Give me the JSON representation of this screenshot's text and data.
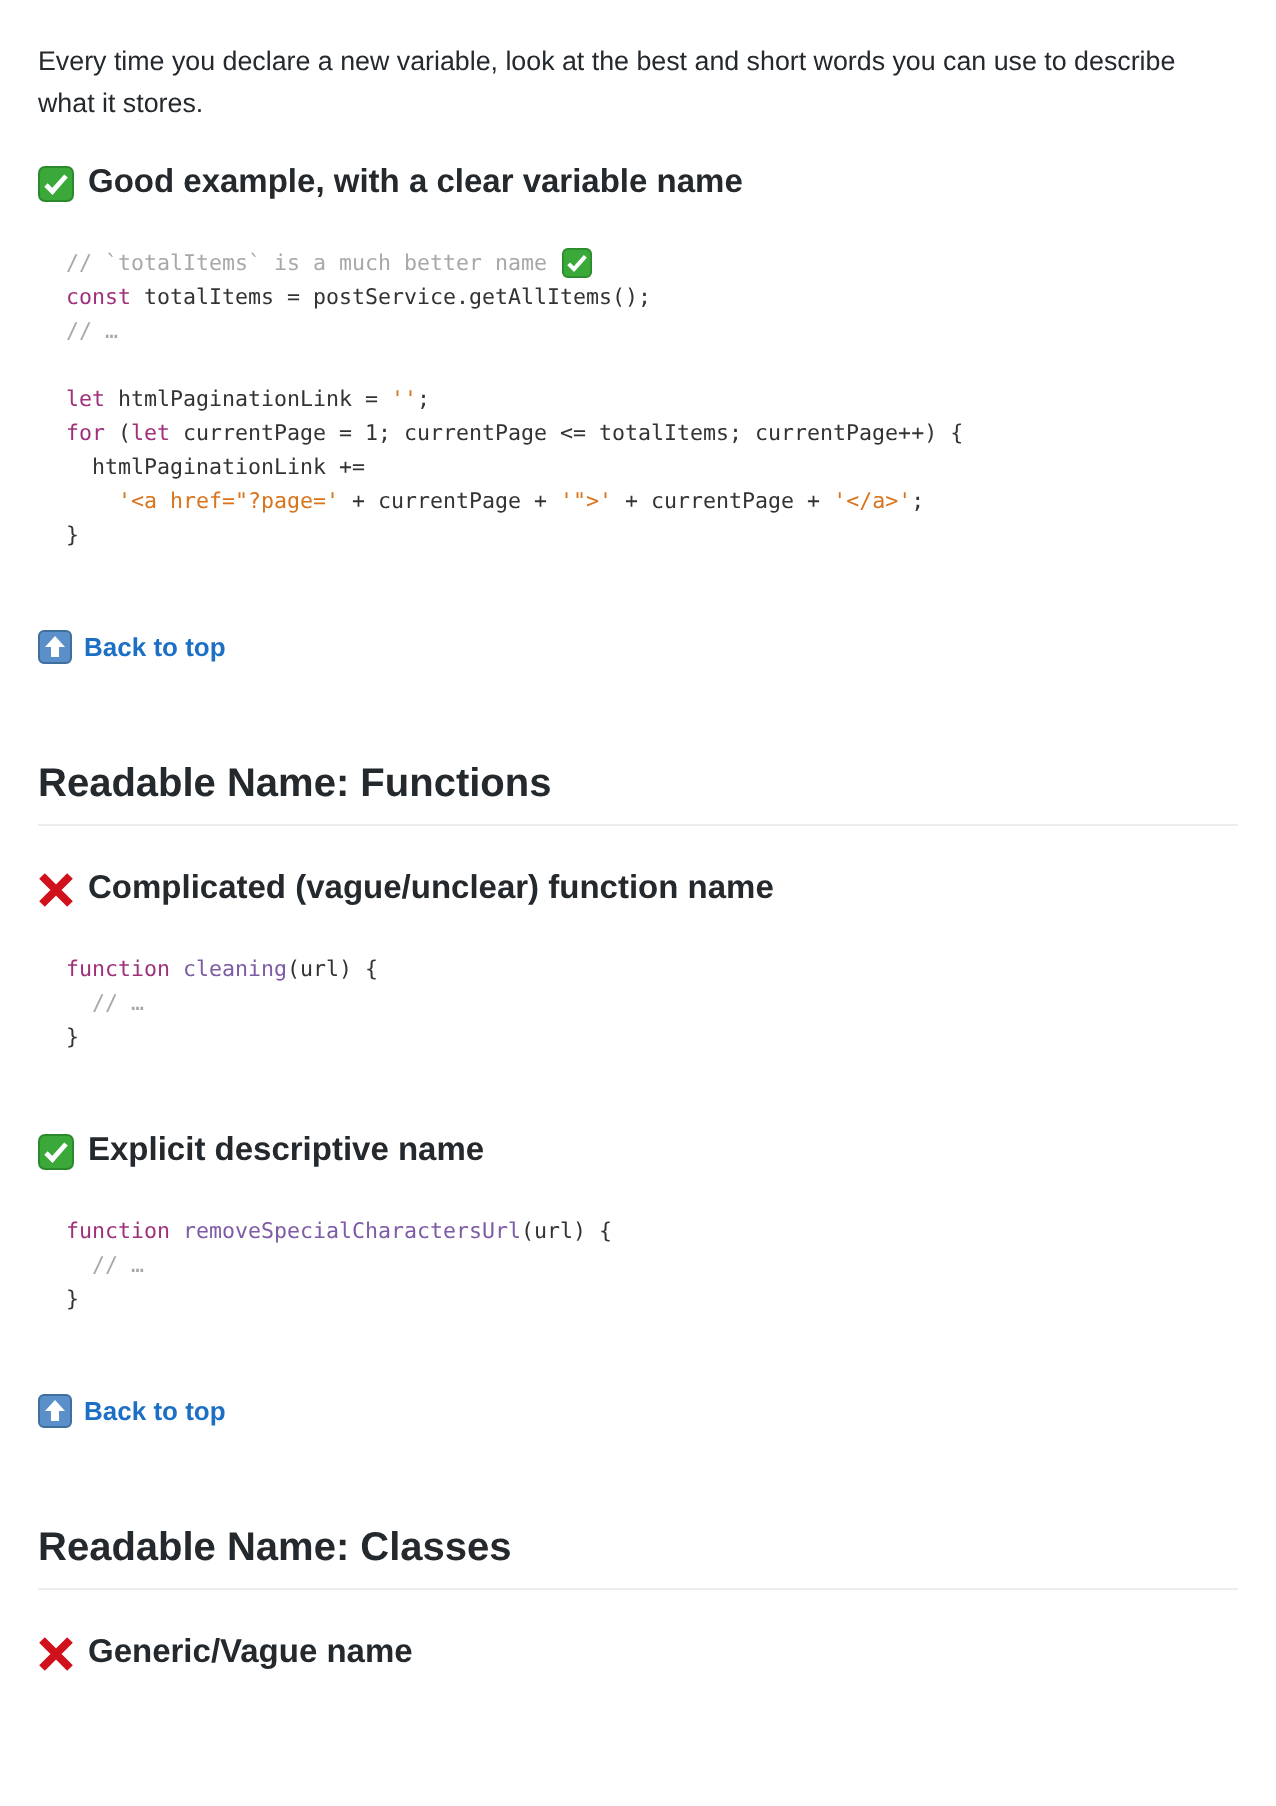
{
  "blocks": [
    {
      "kind": "paragraph",
      "text": "Every time you declare a new variable, look at the best and short words you can use to describe what it stores."
    },
    {
      "kind": "pro",
      "text": "Good example, with a clear variable name"
    },
    {
      "kind": "code",
      "lines": [
        {
          "kind": "checked",
          "tokens": [
            {
              "kind": "comment",
              "t": "// `totalItems` is a much better name"
            }
          ]
        },
        {
          "kind": "plain",
          "tokens": [
            {
              "kind": "keyword",
              "t": "const"
            },
            {
              "kind": "plain",
              "t": " totalItems = postService.getAllItems();"
            }
          ]
        },
        {
          "kind": "plain",
          "tokens": [
            {
              "kind": "comment",
              "t": "// …"
            }
          ]
        },
        {
          "kind": "blank"
        },
        {
          "kind": "plain",
          "tokens": [
            {
              "kind": "keyword",
              "t": "let"
            },
            {
              "kind": "plain",
              "t": " htmlPaginationLink = "
            },
            {
              "kind": "string",
              "t": "''"
            },
            {
              "kind": "plain",
              "t": ";"
            }
          ]
        },
        {
          "kind": "plain",
          "tokens": [
            {
              "kind": "keyword",
              "t": "for"
            },
            {
              "kind": "plain",
              "t": " ("
            },
            {
              "kind": "keyword",
              "t": "let"
            },
            {
              "kind": "plain",
              "t": " currentPage = 1; currentPage <= totalItems; currentPage++) {"
            }
          ]
        },
        {
          "kind": "plain",
          "tokens": [
            {
              "kind": "plain",
              "t": "  htmlPaginationLink +="
            }
          ]
        },
        {
          "kind": "plain",
          "tokens": [
            {
              "kind": "string",
              "t": "    '<a href=\"?page='"
            },
            {
              "kind": "plain",
              "t": " + currentPage + "
            },
            {
              "kind": "string",
              "t": "'\">'"
            },
            {
              "kind": "plain",
              "t": " + currentPage + "
            },
            {
              "kind": "string",
              "t": "'</a>'"
            },
            {
              "kind": "plain",
              "t": ";"
            }
          ]
        },
        {
          "kind": "plain",
          "tokens": [
            {
              "kind": "plain",
              "t": "}"
            }
          ]
        }
      ]
    },
    {
      "kind": "backlink",
      "text": "Back to top"
    },
    {
      "kind": "h2",
      "text": "Readable Name: Functions"
    },
    {
      "kind": "con",
      "text": "Complicated (vague/unclear) function name"
    },
    {
      "kind": "code",
      "lines": [
        {
          "kind": "plain",
          "tokens": [
            {
              "kind": "keyword",
              "t": "function "
            },
            {
              "kind": "func",
              "t": "cleaning"
            },
            {
              "kind": "plain",
              "t": "(url) {"
            }
          ]
        },
        {
          "kind": "plain",
          "tokens": [
            {
              "kind": "comment",
              "t": "  // …"
            }
          ]
        },
        {
          "kind": "plain",
          "tokens": [
            {
              "kind": "plain",
              "t": "}"
            }
          ]
        }
      ]
    },
    {
      "kind": "pro",
      "text": "Explicit descriptive name"
    },
    {
      "kind": "code",
      "lines": [
        {
          "kind": "plain",
          "tokens": [
            {
              "kind": "keyword",
              "t": "function "
            },
            {
              "kind": "func",
              "t": "removeSpecialCharactersUrl"
            },
            {
              "kind": "plain",
              "t": "(url) {"
            }
          ]
        },
        {
          "kind": "plain",
          "tokens": [
            {
              "kind": "comment",
              "t": "  // …"
            }
          ]
        },
        {
          "kind": "plain",
          "tokens": [
            {
              "kind": "plain",
              "t": "}"
            }
          ]
        }
      ]
    },
    {
      "kind": "backlink",
      "text": "Back to top"
    },
    {
      "kind": "h2",
      "text": "Readable Name: Classes"
    },
    {
      "kind": "con",
      "text": "Generic/Vague name"
    }
  ]
}
